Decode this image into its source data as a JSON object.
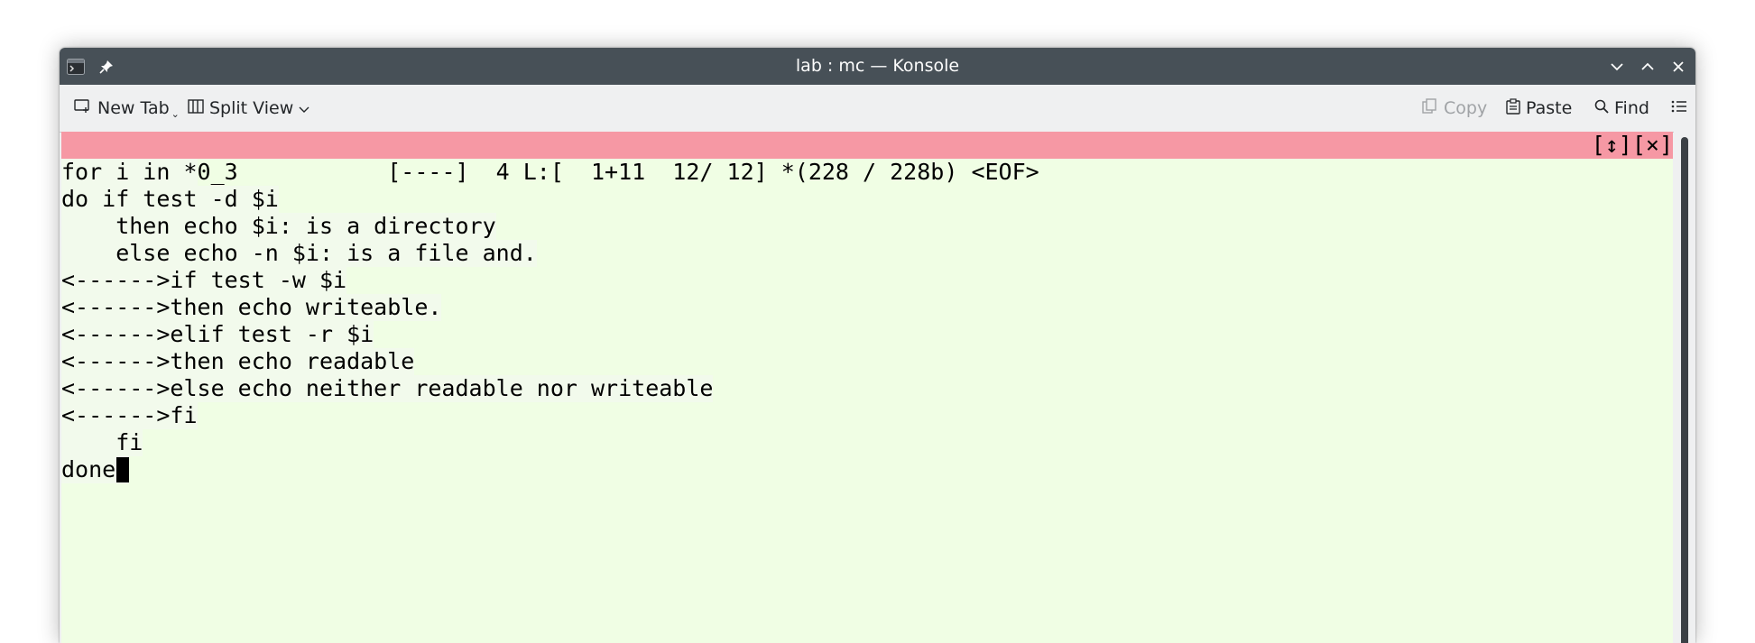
{
  "window": {
    "title": "lab : mc — Konsole",
    "icons": [
      "terminal-app-icon",
      "pin-icon",
      "minimize-icon",
      "maximize-icon",
      "close-icon"
    ]
  },
  "toolbar": {
    "new_tab": "New Tab",
    "split_view": "Split View",
    "copy": "Copy",
    "paste": "Paste",
    "find": "Find"
  },
  "editor": {
    "status_left": "lab10_3           [----]  4 L:[  1+11  12/ 12] *(228 / 228b) <EOF>",
    "status_right": "[↕][×]",
    "lines": [
      "for i in *",
      "do if test -d $i",
      "    then echo $i: is a directory",
      "    else echo -n $i: is a file and.",
      "<------>if test -w $i",
      "<------>then echo writeable.",
      "<------>elif test -r $i",
      "<------>then echo readable",
      "<------>else echo neither readable nor writeable",
      "<------>fi",
      "    fi",
      "done"
    ]
  },
  "colors": {
    "titlebar": "#475057",
    "status_bar": "#f698a4",
    "editor_bg": "#f0fee4"
  }
}
